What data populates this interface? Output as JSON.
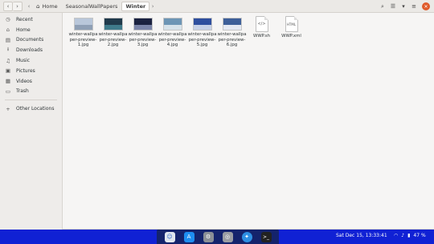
{
  "breadcrumbs": [
    "Home",
    "SeasonalWallPapers",
    "Winter"
  ],
  "sidebar": {
    "items": [
      {
        "label": "Recent",
        "icon": "clock-icon"
      },
      {
        "label": "Home",
        "icon": "home-icon"
      },
      {
        "label": "Documents",
        "icon": "document-icon"
      },
      {
        "label": "Downloads",
        "icon": "download-icon"
      },
      {
        "label": "Music",
        "icon": "music-icon"
      },
      {
        "label": "Pictures",
        "icon": "camera-icon"
      },
      {
        "label": "Videos",
        "icon": "film-icon"
      },
      {
        "label": "Trash",
        "icon": "trash-icon"
      }
    ],
    "other": {
      "label": "Other Locations",
      "icon": "plus-icon"
    }
  },
  "files": [
    {
      "name": "winter-wallpaper-preview-1.jpg",
      "kind": "image",
      "sky": "#b9c7da",
      "ground": "#8f9fb5"
    },
    {
      "name": "winter-wallpaper-preview-2.jpg",
      "kind": "image",
      "sky": "#203a4b",
      "ground": "#3f7a8a"
    },
    {
      "name": "winter-wallpaper-preview-3.jpg",
      "kind": "image",
      "sky": "#1b2240",
      "ground": "#7a84a8"
    },
    {
      "name": "winter-wallpaper-preview-4.jpg",
      "kind": "image",
      "sky": "#6d95b5",
      "ground": "#d7e2ea"
    },
    {
      "name": "winter-wallpaper-preview-5.jpg",
      "kind": "image",
      "sky": "#2f4f9e",
      "ground": "#c7d1e6"
    },
    {
      "name": "winter-wallpaper-preview-6.jpg",
      "kind": "image",
      "sky": "#3d5f99",
      "ground": "#e4e9f3"
    },
    {
      "name": "WWP.sh",
      "kind": "script",
      "glyph": "</>"
    },
    {
      "name": "WWP.xml",
      "kind": "xml",
      "glyph": "HTML"
    }
  ],
  "taskbar": {
    "clock": "Sat Dec 15, 13:33:41",
    "battery": "47 %",
    "accent": "#1021d4",
    "dock_icons": [
      "finder-icon",
      "app-store-icon",
      "settings-icon",
      "disk-icon",
      "safari-icon",
      "terminal-icon"
    ]
  }
}
